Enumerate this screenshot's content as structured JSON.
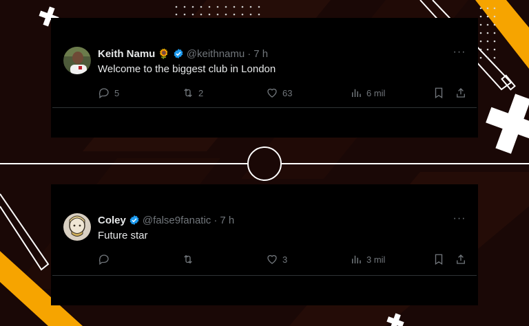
{
  "colors": {
    "background": "#1a0806",
    "accent_orange": "#f6a400",
    "tweet_bg": "#000000",
    "verified_blue": "#1d9bf0",
    "text_primary": "#e7e9ea",
    "text_secondary": "#71767b"
  },
  "tweets": [
    {
      "name": "Keith Namu",
      "emoji": "🌻",
      "handle": "@keithnamu",
      "separator": "·",
      "time": "7 h",
      "text": "Welcome to the biggest club in London",
      "replies": "5",
      "retweets": "2",
      "likes": "63",
      "views": "6 mil"
    },
    {
      "name": "Coley",
      "handle": "@false9fanatic",
      "separator": "·",
      "time": "7 h",
      "text": "Future star",
      "replies": "",
      "retweets": "",
      "likes": "3",
      "views": "3 mil"
    }
  ],
  "icons": {
    "more": "more-icon",
    "reply": "reply-icon",
    "retweet": "retweet-icon",
    "like": "heart-icon",
    "views": "views-icon",
    "bookmark": "bookmark-icon",
    "share": "share-icon",
    "verified": "verified-badge-icon"
  }
}
